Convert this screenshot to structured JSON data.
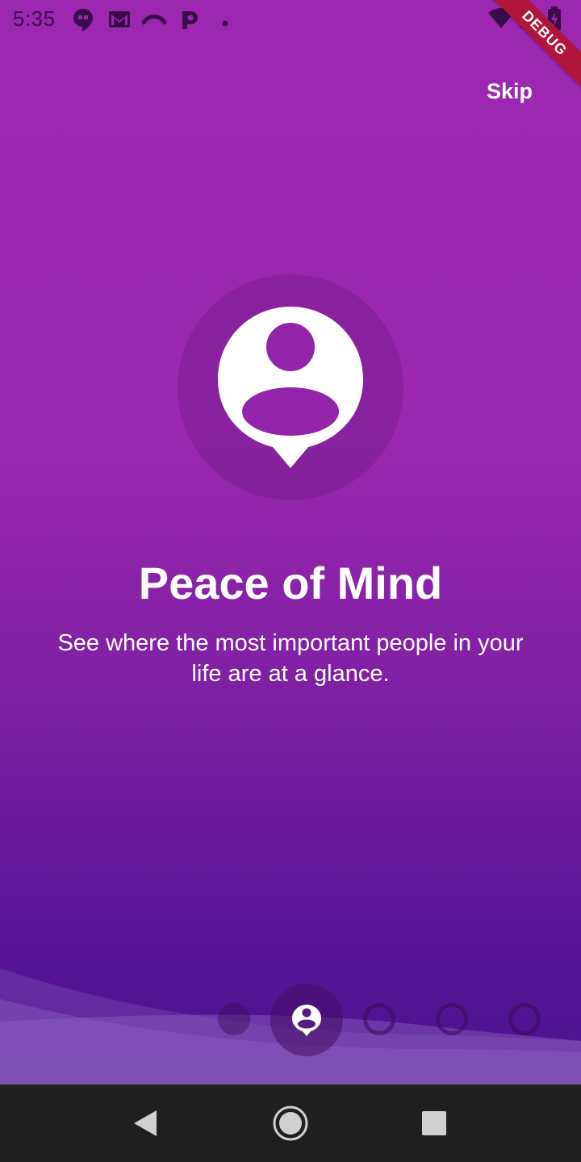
{
  "status_bar": {
    "time": "5:35",
    "icons": [
      "hangouts-icon",
      "gmail-icon",
      "signal-arc-icon",
      "parking-icon",
      "dot-icon",
      "wifi-icon",
      "cell-signal-icon",
      "battery-charging-icon"
    ]
  },
  "debug_banner": {
    "label": "DEBUG",
    "color": "#b0163a"
  },
  "header": {
    "skip_label": "Skip"
  },
  "onboarding": {
    "icon": "person-pin-icon",
    "title": "Peace of Mind",
    "description": "See where the most important people in your life are at a glance.",
    "page_count": 5,
    "current_page": 2
  },
  "nav_bar": {
    "icons": [
      "back-icon",
      "home-icon",
      "recents-icon"
    ]
  },
  "colors": {
    "background_top": "#9c27b0",
    "background_bottom": "#45108a",
    "nav_bar": "#1f1f1f",
    "text": "#ffffff"
  }
}
